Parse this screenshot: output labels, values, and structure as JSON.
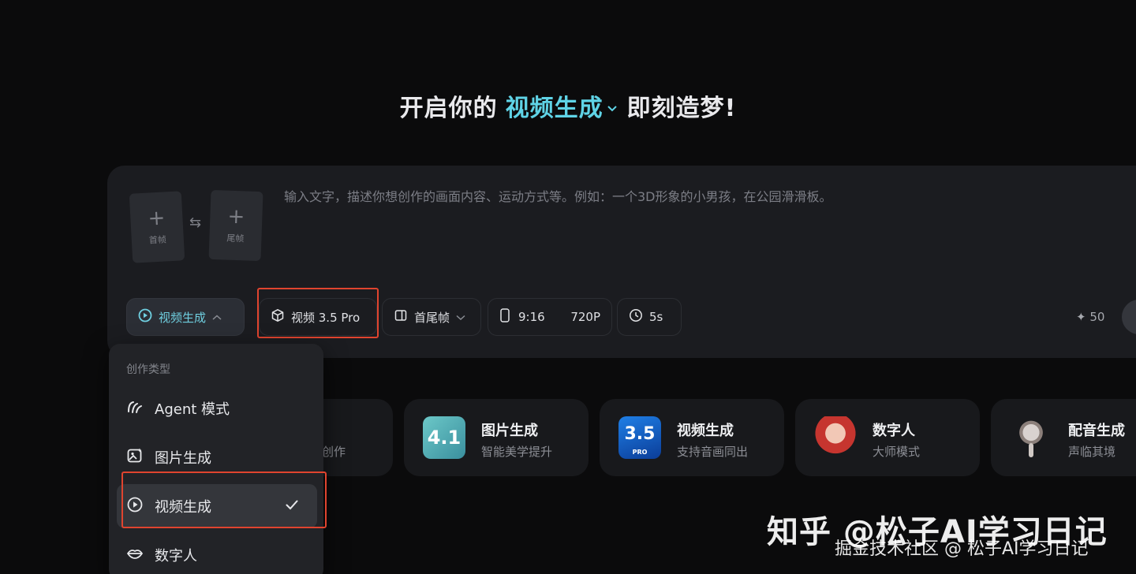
{
  "headline": {
    "prefix": "开启你的",
    "mode": "视频生成",
    "suffix": "即刻造梦!"
  },
  "composer": {
    "first_frame_label": "首帧",
    "last_frame_label": "尾帧",
    "prompt_placeholder": "输入文字，描述你想创作的画面内容、运动方式等。例如：一个3D形象的小男孩，在公园滑滑板。",
    "toolbar": {
      "mode_label": "视频生成",
      "model_label": "视频 3.5 Pro",
      "frames_label": "首尾帧",
      "ratio_label": "9:16",
      "resolution_label": "720P",
      "duration_label": "5s",
      "credits": "50"
    }
  },
  "shortcuts": [
    {
      "title": "",
      "subtitle": "创作"
    },
    {
      "title": "图片生成",
      "subtitle": "智能美学提升",
      "badge": "4.1"
    },
    {
      "title": "视频生成",
      "subtitle": "支持音画同出",
      "badge": "3.5",
      "badge_sub": "PRO"
    },
    {
      "title": "数字人",
      "subtitle": "大师模式"
    },
    {
      "title": "配音生成",
      "subtitle": "声临其境"
    }
  ],
  "dropdown": {
    "header": "创作类型",
    "items": [
      {
        "label": "Agent 模式",
        "icon": "agent-icon"
      },
      {
        "label": "图片生成",
        "icon": "image-gen-icon"
      },
      {
        "label": "视频生成",
        "icon": "video-gen-icon",
        "selected": true
      },
      {
        "label": "数字人",
        "icon": "lips-icon"
      }
    ]
  },
  "watermark": {
    "main": "知乎 @松子AI学习日记",
    "sub": "掘金技术社区 @ 松子AI学习日记"
  },
  "colors": {
    "background": "#0b0b0c",
    "accent": "#5fd3e6",
    "panel": "#1b1c20",
    "highlight_box": "#e0442f"
  }
}
